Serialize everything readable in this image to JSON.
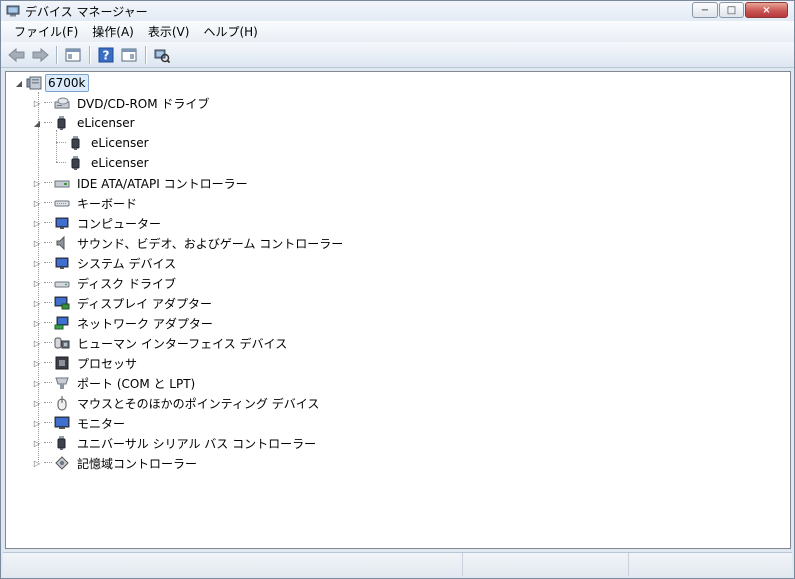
{
  "window": {
    "title": "デバイス マネージャー",
    "controls": {
      "minimize": "−",
      "maximize": "□",
      "close": "×"
    }
  },
  "menu": {
    "items": [
      {
        "label": "ファイル(F)"
      },
      {
        "label": "操作(A)"
      },
      {
        "label": "表示(V)"
      },
      {
        "label": "ヘルプ(H)"
      }
    ]
  },
  "toolbar": {
    "buttons": [
      "back-arrow-icon",
      "forward-arrow-icon",
      "properties-icon",
      "help-icon",
      "view-icon",
      "scan-hardware-icon"
    ]
  },
  "tree": {
    "root": {
      "label": "6700k",
      "icon": "computer-icon",
      "expanded": true
    },
    "items": [
      {
        "label": "DVD/CD-ROM ドライブ",
        "icon": "dvd-drive-icon",
        "expanded": false
      },
      {
        "label": "eLicenser",
        "icon": "usb-key-icon",
        "expanded": true,
        "children": [
          {
            "label": "eLicenser",
            "icon": "usb-key-icon"
          },
          {
            "label": "eLicenser",
            "icon": "usb-key-icon"
          }
        ]
      },
      {
        "label": "IDE ATA/ATAPI コントローラー",
        "icon": "ide-controller-icon",
        "expanded": false
      },
      {
        "label": "キーボード",
        "icon": "keyboard-icon",
        "expanded": false
      },
      {
        "label": "コンピューター",
        "icon": "computer-monitor-icon",
        "expanded": false
      },
      {
        "label": "サウンド、ビデオ、およびゲーム コントローラー",
        "icon": "speaker-icon",
        "expanded": false
      },
      {
        "label": "システム デバイス",
        "icon": "system-device-icon",
        "expanded": false
      },
      {
        "label": "ディスク ドライブ",
        "icon": "disk-drive-icon",
        "expanded": false
      },
      {
        "label": "ディスプレイ アダプター",
        "icon": "display-adapter-icon",
        "expanded": false
      },
      {
        "label": "ネットワーク アダプター",
        "icon": "network-adapter-icon",
        "expanded": false
      },
      {
        "label": "ヒューマン インターフェイス デバイス",
        "icon": "hid-icon",
        "expanded": false
      },
      {
        "label": "プロセッサ",
        "icon": "processor-icon",
        "expanded": false
      },
      {
        "label": "ポート (COM と LPT)",
        "icon": "port-icon",
        "expanded": false
      },
      {
        "label": "マウスとそのほかのポインティング デバイス",
        "icon": "mouse-icon",
        "expanded": false
      },
      {
        "label": "モニター",
        "icon": "monitor-icon",
        "expanded": false
      },
      {
        "label": "ユニバーサル シリアル バス コントローラー",
        "icon": "usb-controller-icon",
        "expanded": false
      },
      {
        "label": "記憶域コントローラー",
        "icon": "storage-controller-icon",
        "expanded": false
      }
    ]
  },
  "colors": {
    "selection_bg": "#dcecfc",
    "selection_border": "#7da2ce",
    "chrome": "#dfe7f1"
  }
}
